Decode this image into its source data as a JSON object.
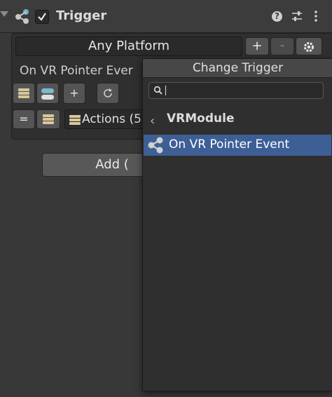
{
  "header": {
    "title": "Trigger",
    "enabled": true,
    "help_icon": "question-icon",
    "settings_icon": "sliders-icon",
    "more_icon": "kebab-icon"
  },
  "platform": {
    "value": "Any Platform",
    "add_label": "+",
    "remove_label": "-"
  },
  "event_label": "On VR Pointer Ever",
  "toolbar": {
    "add_label": "+"
  },
  "actions_row": {
    "equals_label": "=",
    "actions_label": "Actions (5"
  },
  "add_button_label": "Add (",
  "popup": {
    "title": "Change Trigger",
    "search": {
      "value": "",
      "placeholder": ""
    },
    "breadcrumb": "VRModule",
    "results": [
      "On VR Pointer Event"
    ]
  },
  "colors": {
    "background": "#383838",
    "panel": "#2f2f2f",
    "selection": "#3e5f96",
    "button": "#545454"
  }
}
